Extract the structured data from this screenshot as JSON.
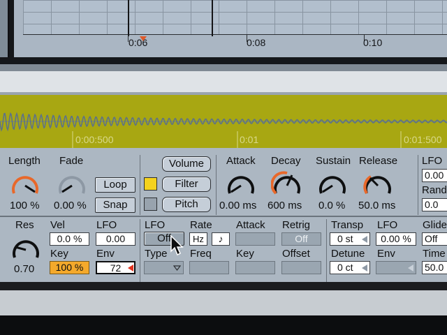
{
  "timeline": {
    "marks": [
      "0:06",
      "0:08",
      "0:10"
    ]
  },
  "sample": {
    "ruler": [
      "0:00:500",
      "0:01",
      "0:01:500"
    ],
    "waveform_color": "#a8a712"
  },
  "voice": {
    "length": {
      "label": "Length",
      "value": "100 %",
      "color": "#e8682a"
    },
    "fade": {
      "label": "Fade",
      "value": "0.00 %",
      "color": "#8d98a4"
    },
    "loop_label": "Loop",
    "snap_label": "Snap"
  },
  "targets": {
    "volume_label": "Volume",
    "filter_label": "Filter",
    "pitch_label": "Pitch",
    "active_color": "#f4d21e"
  },
  "envelope": {
    "attack": {
      "label": "Attack",
      "value": "0.00 ms"
    },
    "decay": {
      "label": "Decay",
      "value": "600 ms"
    },
    "sustain": {
      "label": "Sustain",
      "value": "0.0 %"
    },
    "release": {
      "label": "Release",
      "value": "50.0 ms"
    }
  },
  "right_col": {
    "lfo_label": "LFO",
    "lfo_value": "0.00",
    "rand_label": "Rand",
    "rand_value": "0.0"
  },
  "filter": {
    "res_label": "Res",
    "res_value": "0.70",
    "vel_label": "Vel",
    "vel_value": "0.0 %",
    "lfo_label": "LFO",
    "lfo_value": "0.00",
    "key_label": "Key",
    "key_value": "100 %",
    "env_label": "Env",
    "env_value": "72"
  },
  "lfo": {
    "lfo_label": "LFO",
    "lfo_state": "Off",
    "rate_label": "Rate",
    "rate_unit": "Hz",
    "sync_glyph": "♪",
    "attack_label": "Attack",
    "retrig_label": "Retrig",
    "retrig_state": "Off",
    "type_label": "Type",
    "freq_label": "Freq",
    "key_label": "Key",
    "offset_label": "Offset"
  },
  "pitch": {
    "transp_label": "Transp",
    "transp_value": "0 st",
    "lfo_label": "LFO",
    "lfo_value": "0.00 %",
    "glide_label": "Glide",
    "glide_value": "Off",
    "detune_label": "Detune",
    "detune_value": "0 ct",
    "env_label": "Env",
    "time_label": "Time",
    "time_value": "50.0"
  }
}
